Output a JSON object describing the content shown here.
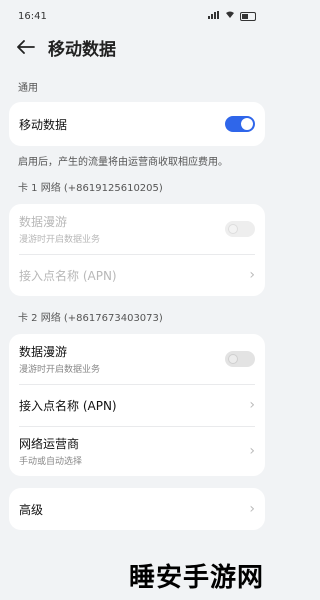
{
  "status_bar": {
    "time": "16:41"
  },
  "header": {
    "title": "移动数据"
  },
  "general": {
    "section_label": "通用",
    "mobile_data_label": "移动数据",
    "note": "启用后，产生的流量将由运营商收取相应费用。"
  },
  "sim1": {
    "section_label": "卡 1 网络 (+8619125610205)",
    "roaming_label": "数据漫游",
    "roaming_sub": "漫游时开启数据业务",
    "apn_label": "接入点名称 (APN)"
  },
  "sim2": {
    "section_label": "卡 2 网络 (+8617673403073)",
    "roaming_label": "数据漫游",
    "roaming_sub": "漫游时开启数据业务",
    "apn_label": "接入点名称 (APN)",
    "operator_label": "网络运营商",
    "operator_sub": "手动或自动选择"
  },
  "advanced": {
    "label": "高级"
  },
  "watermark": "睡安手游网",
  "colors": {
    "accent": "#2f66ea",
    "background": "#f1f3f5"
  }
}
